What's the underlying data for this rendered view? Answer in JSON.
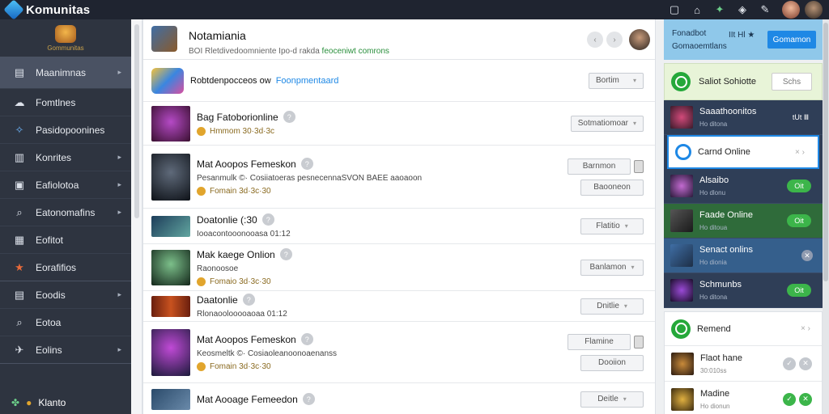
{
  "app": {
    "title": "Komunitas"
  },
  "topbar": {
    "icons": [
      "chat-icon",
      "bookmark-icon",
      "puzzle-icon",
      "shield-icon",
      "edit-icon"
    ]
  },
  "sidebar": {
    "logo_caption": "Gommunitas",
    "items": [
      {
        "label": "Maanimnas",
        "icon": "list-icon",
        "chevron": true,
        "active": true
      },
      {
        "label": "Fomtlnes",
        "icon": "cloud-icon",
        "chevron": false
      },
      {
        "label": "Pasidopoonines",
        "icon": "puzzle-icon",
        "chevron": false
      },
      {
        "label": "Konrites",
        "icon": "book-icon",
        "chevron": true
      },
      {
        "label": "Eafiolotoa",
        "icon": "square-icon",
        "chevron": true
      },
      {
        "label": "Eatonomafins",
        "icon": "search-icon",
        "chevron": true
      },
      {
        "label": "Eofitot",
        "icon": "calendar-icon",
        "chevron": false
      },
      {
        "label": "Eorafifios",
        "icon": "star-icon",
        "chevron": false
      },
      {
        "label": "Eoodis",
        "icon": "grid-icon",
        "chevron": true
      },
      {
        "label": "Eotoa",
        "icon": "search-icon",
        "chevron": false
      },
      {
        "label": "Eolins",
        "icon": "plane-icon",
        "chevron": true
      }
    ],
    "footer_label": "Klanto"
  },
  "main": {
    "header": {
      "title": "Notamiania",
      "subtitle": "BOI Rletdivedoomniente Ipo-d rakda",
      "subtitle_highlight": "feoceniwt comrons"
    },
    "filter_row": {
      "label": "Robtdenpocceos ow",
      "label_highlight": "Foonpmentaard",
      "button": "Bortim"
    },
    "rows": [
      {
        "title": "Bag Fatoborionline",
        "meta": "Hmmom 30·3d·3c",
        "buttons": [
          "Sotmatiomoar"
        ]
      },
      {
        "title": "Mat Aoopos Femeskon",
        "desc": "Pesanmulk ©· Cosiiatoeras pesnecennaSVON BAEE aaoaoon",
        "meta": "Fomain 3d·3c·30",
        "buttons": [
          "Barnmon",
          "Baooneon"
        ]
      },
      {
        "title": "Doatonlie (:30",
        "desc": "Iooacontooonooasa 01:12",
        "buttons": [
          "Flatitio"
        ]
      },
      {
        "title": "Mak kaege Onlion",
        "desc": "Raonoosoe",
        "meta": "Fomaio 3d·3c·30",
        "buttons": [
          "Banlamon"
        ]
      },
      {
        "title": "Daatonlie",
        "desc": "Rlonaoolooooaoaa 01:12",
        "buttons": [
          "Dnitlie"
        ]
      },
      {
        "title": "Mat Aoopos Femeskon",
        "desc": "Keosmeltk ©· Cosiaoleanoonoaenanss",
        "meta": "Fomain 3d·3c·30",
        "buttons": [
          "Flamine",
          "Dooiion"
        ]
      },
      {
        "title": "Mat Aooage Femeedon",
        "meta": "",
        "buttons": [
          "Deitle"
        ]
      }
    ]
  },
  "right": {
    "top": {
      "line1": "Fonadbot",
      "line2": "Gomaoemtlans",
      "tag": "IIt Hl ★",
      "button": "Gomamon"
    },
    "search": {
      "label": "Saliot Sohiotte",
      "button": "Schs"
    },
    "online": [
      {
        "name": "Saaathoonitos",
        "sub": "Ho ditona",
        "badge": "tUt Ⅲ"
      },
      {
        "name": "Carnd Online",
        "sub": ""
      },
      {
        "name": "Alsaibo",
        "sub": "Ho dlonu",
        "badge": "Oit"
      },
      {
        "name": "Faade Online",
        "sub": "Ho ditoua",
        "badge": "Oit"
      },
      {
        "name": "Senact onlins",
        "sub": "Ho dionia",
        "badge": ""
      },
      {
        "name": "Schmunbs",
        "sub": "Ho ditona",
        "badge": "Oit"
      }
    ],
    "lower": [
      {
        "name": "Remend",
        "sub": ""
      },
      {
        "name": "Flaot hane",
        "sub": "30:010ss"
      },
      {
        "name": "Madine",
        "sub": "Ho dionun"
      }
    ]
  }
}
